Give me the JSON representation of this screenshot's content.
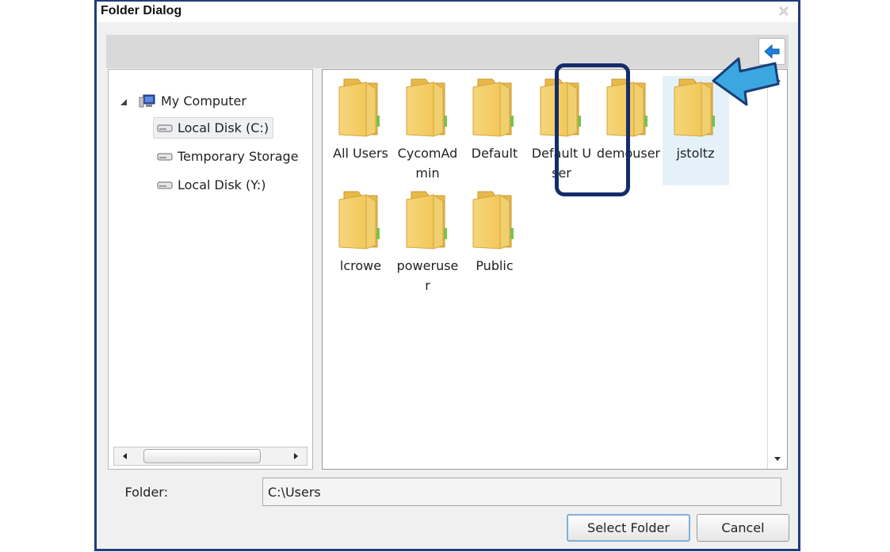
{
  "dialog": {
    "title": "Folder Dialog"
  },
  "tree": {
    "root": {
      "label": "My Computer",
      "icon": "computer-icon",
      "expanded": true
    },
    "items": [
      {
        "label": "Local Disk (C:)",
        "icon": "drive-icon",
        "selected": true
      },
      {
        "label": "Temporary Storage",
        "icon": "drive-icon",
        "selected": false
      },
      {
        "label": "Local Disk (Y:)",
        "icon": "drive-icon",
        "selected": false
      }
    ]
  },
  "files": [
    {
      "label": "All Users",
      "icon": "folder-icon"
    },
    {
      "label": "CycomAdmin",
      "icon": "folder-icon"
    },
    {
      "label": "Default",
      "icon": "folder-icon"
    },
    {
      "label": "Default User",
      "icon": "folder-icon"
    },
    {
      "label": "demouser",
      "icon": "folder-icon"
    },
    {
      "label": "jstoltz",
      "icon": "folder-icon",
      "selected": true
    },
    {
      "label": "lcrowe",
      "icon": "folder-icon"
    },
    {
      "label": "poweruser",
      "icon": "folder-icon"
    },
    {
      "label": "Public",
      "icon": "folder-icon"
    }
  ],
  "folder_field": {
    "label": "Folder:",
    "value": "C:\\Users"
  },
  "buttons": {
    "select": "Select Folder",
    "cancel": "Cancel"
  },
  "colors": {
    "frame": "#1f3d7a",
    "callout_arrow": "#3aa7e0",
    "highlight": "#142c6a",
    "selection": "#e4f1f9"
  }
}
